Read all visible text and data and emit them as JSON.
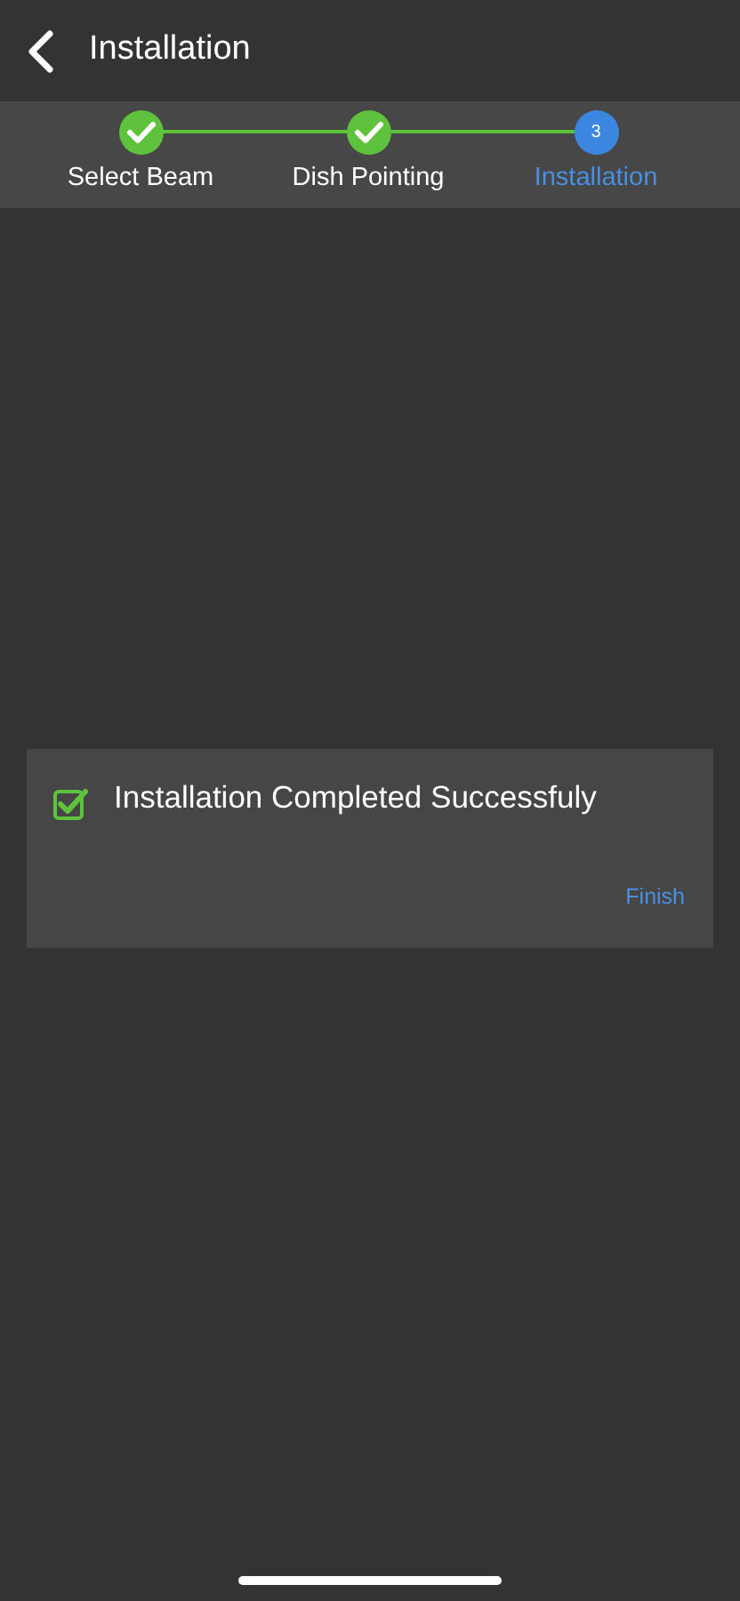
{
  "header": {
    "title": "Installation"
  },
  "steps": [
    {
      "label": "Select Beam",
      "completed": true,
      "selected": false
    },
    {
      "label": "Dish Pointing",
      "completed": true,
      "selected": false
    },
    {
      "label": "Installation",
      "completed": false,
      "selected": true,
      "number": "3"
    }
  ],
  "result": {
    "message": "Installation Completed Successfuly",
    "checked": true,
    "action": "Finish"
  }
}
